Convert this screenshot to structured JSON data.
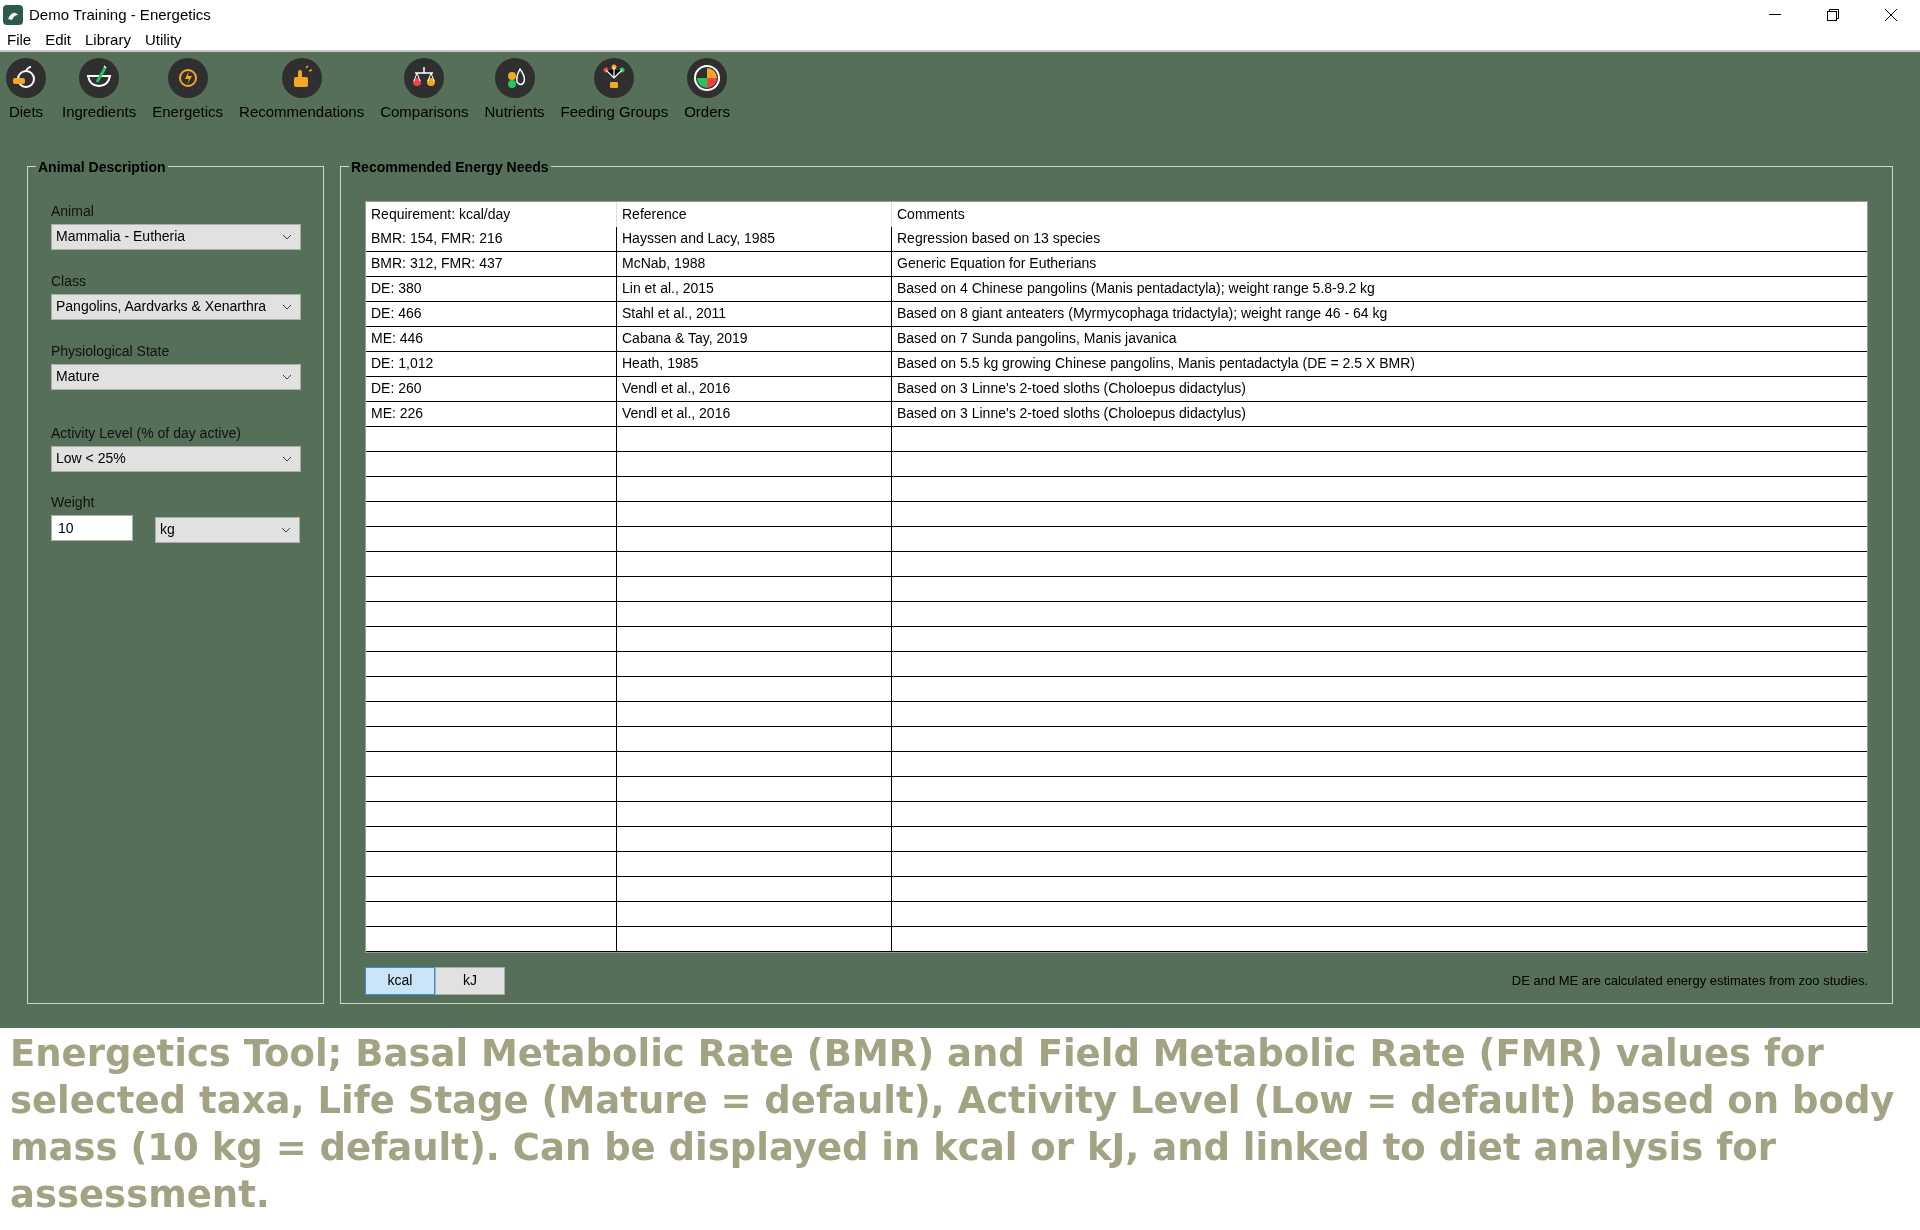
{
  "window": {
    "title": "Demo Training - Energetics"
  },
  "menu": [
    "File",
    "Edit",
    "Library",
    "Utility"
  ],
  "toolbar": [
    {
      "label": "Diets",
      "kind": "apple"
    },
    {
      "label": "Ingredients",
      "kind": "bowl"
    },
    {
      "label": "Energetics",
      "kind": "bolt"
    },
    {
      "label": "Recommendations",
      "kind": "thumb"
    },
    {
      "label": "Comparisons",
      "kind": "scale"
    },
    {
      "label": "Nutrients",
      "kind": "drops"
    },
    {
      "label": "Feeding Groups",
      "kind": "network"
    },
    {
      "label": "Orders",
      "kind": "pie"
    }
  ],
  "animal_description": {
    "title": "Animal Description",
    "fields": [
      {
        "label": "Animal",
        "value": "Mammalia - Eutheria"
      },
      {
        "label": "Class",
        "value": "Pangolins, Aardvarks & Xenarthra"
      },
      {
        "label": "Physiological State",
        "value": "Mature"
      },
      {
        "label": "Activity Level (% of day active)",
        "value": "Low < 25%"
      }
    ],
    "weight": {
      "label": "Weight",
      "value": "10",
      "unit": "kg"
    }
  },
  "energy_needs": {
    "title": "Recommended Energy Needs",
    "columns": [
      "Requirement: kcal/day",
      "Reference",
      "Comments"
    ],
    "rows": [
      [
        "BMR: 154, FMR: 216",
        "Hayssen and Lacy, 1985",
        "Regression based on 13 species"
      ],
      [
        "BMR: 312, FMR: 437",
        "McNab, 1988",
        "Generic Equation for Eutherians"
      ],
      [
        "DE: 380",
        "Lin et al., 2015",
        "Based on 4 Chinese pangolins (Manis pentadactyla); weight range 5.8-9.2 kg"
      ],
      [
        "DE: 466",
        "Stahl et al., 2011",
        "Based on 8 giant anteaters (Myrmycophaga tridactyla); weight range 46 - 64 kg"
      ],
      [
        "ME: 446",
        "Cabana & Tay, 2019",
        "Based on 7 Sunda pangolins, Manis javanica"
      ],
      [
        "DE: 1,012",
        "Heath, 1985",
        "Based on 5.5 kg growing  Chinese pangolins, Manis pentadactyla (DE = 2.5 X BMR)"
      ],
      [
        "DE: 260",
        "Vendl et al., 2016",
        "Based on 3 Linne's 2-toed sloths (Choloepus didactylus)"
      ],
      [
        "ME: 226",
        "Vendl et al., 2016",
        "Based on 3 Linne's 2-toed sloths (Choloepus didactylus)"
      ]
    ],
    "units": [
      {
        "label": "kcal",
        "selected": true
      },
      {
        "label": "kJ",
        "selected": false
      }
    ],
    "note": "DE and ME are calculated energy estimates from zoo studies."
  },
  "caption": "Energetics Tool; Basal Metabolic Rate (BMR) and Field Metabolic Rate (FMR) values for selected taxa, Life Stage (Mature = default), Activity Level (Low = default) based on body mass (10 kg = default).  Can be displayed in kcal or kJ, and linked to diet analysis for assessment."
}
